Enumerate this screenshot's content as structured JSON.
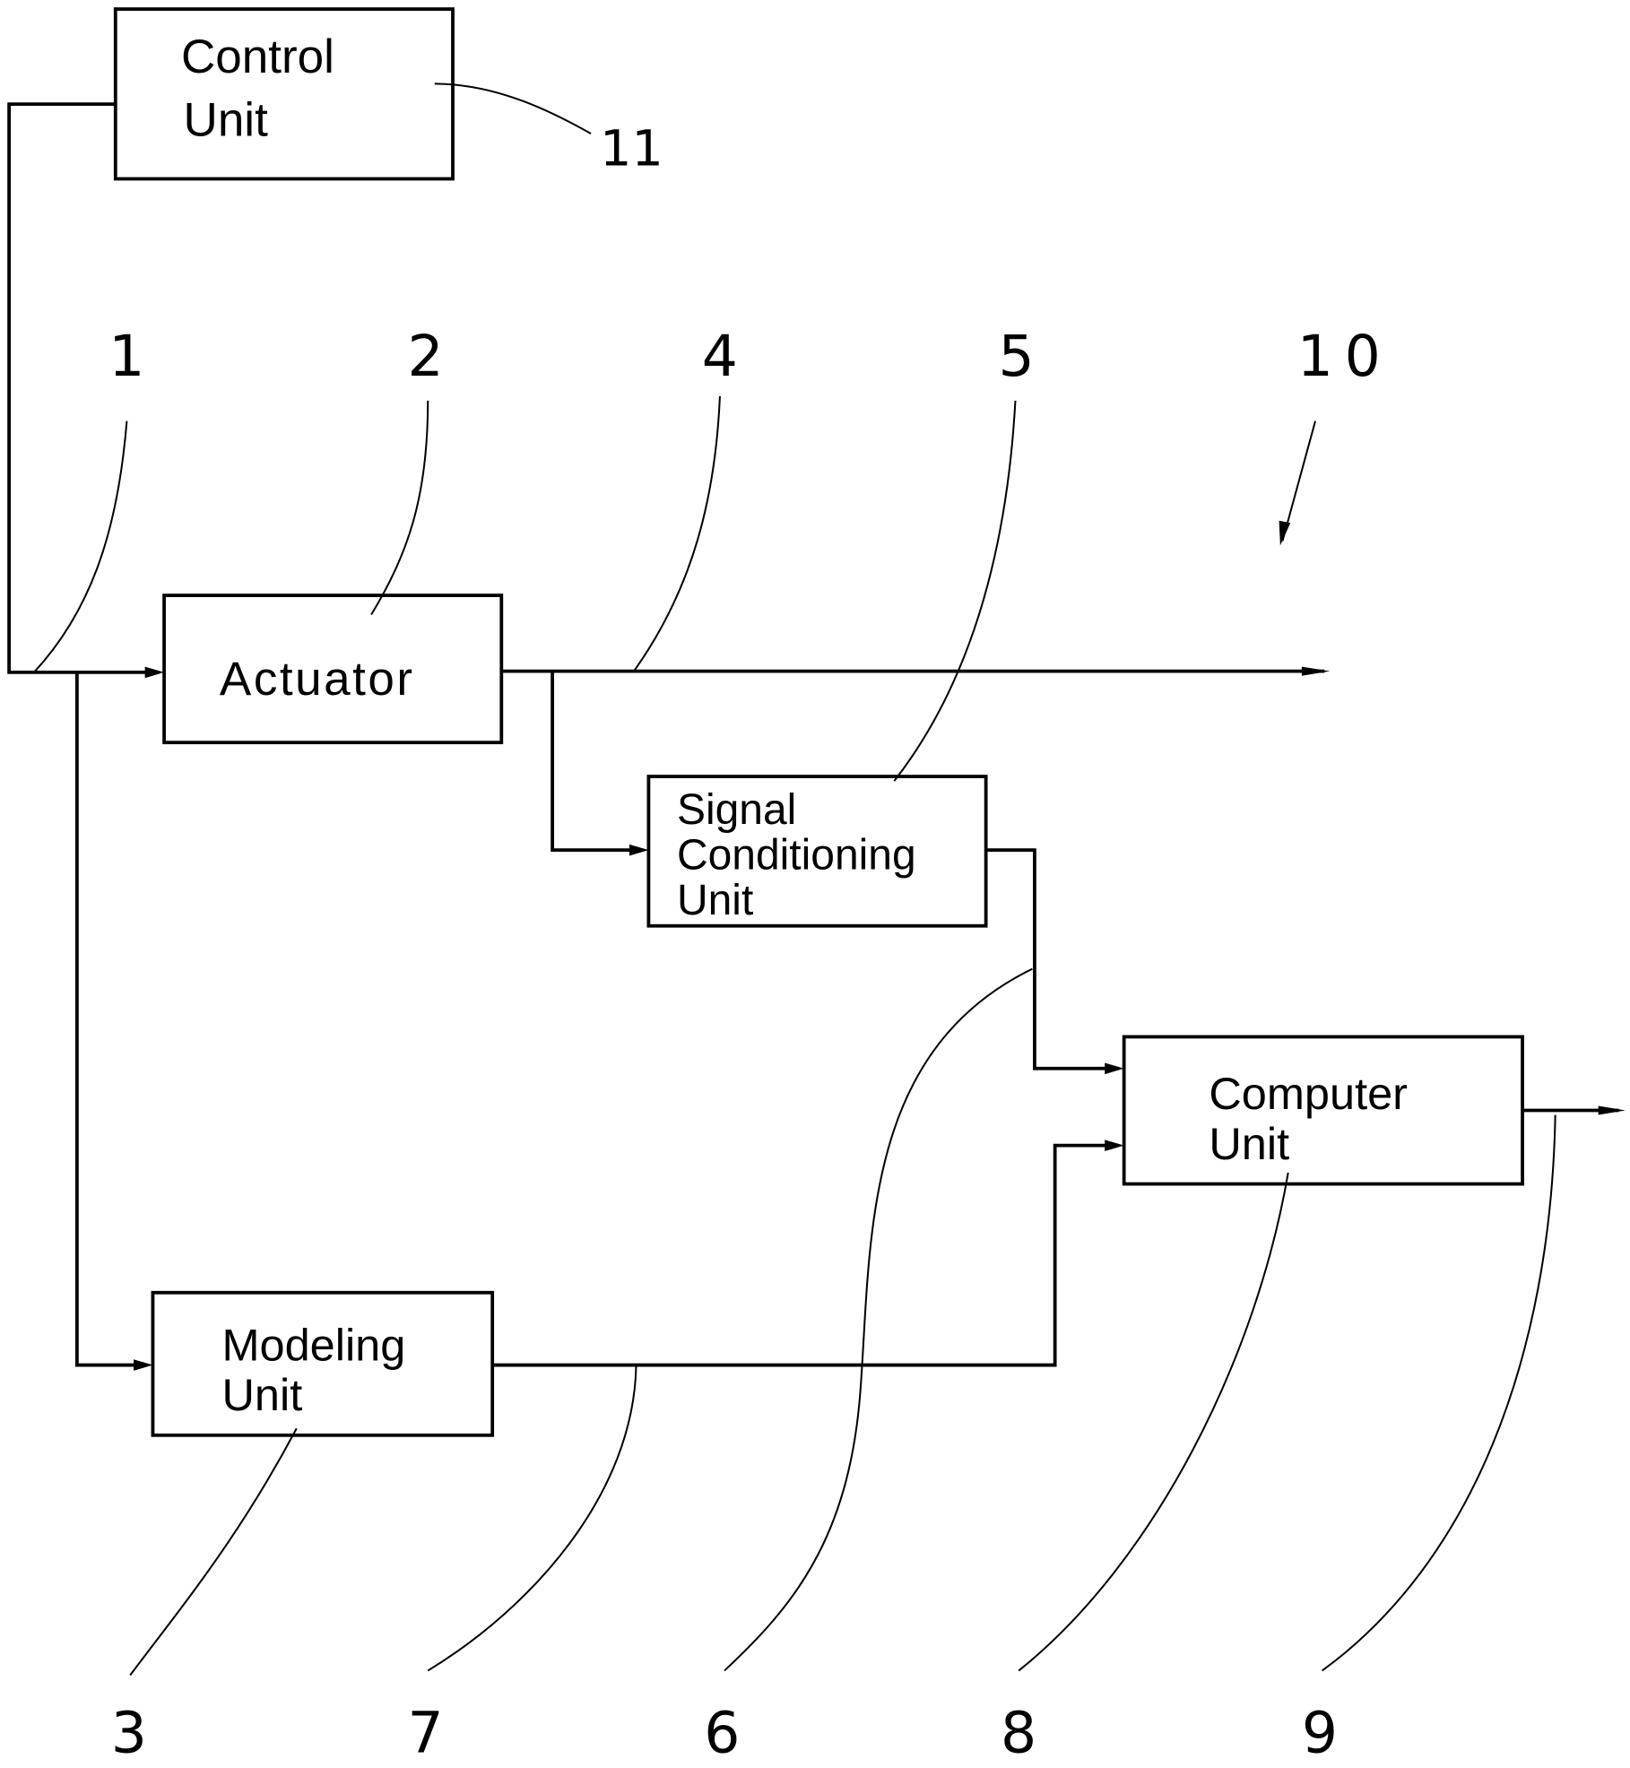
{
  "figure": {
    "blocks": {
      "control_unit": {
        "line1": "Control",
        "line2": "Unit",
        "ref": "11"
      },
      "actuator": {
        "line1": "Actuator",
        "ref": "2"
      },
      "signal_conditioning_unit": {
        "line1": "Signal",
        "line2": "Conditioning",
        "line3": "Unit",
        "ref": "5"
      },
      "computer_unit": {
        "line1": "Computer",
        "line2": "Unit",
        "ref": "8"
      },
      "modeling_unit": {
        "line1": "Modeling",
        "line2": "Unit",
        "ref": "3"
      }
    },
    "references": {
      "input_line": "1",
      "actuator": "2",
      "modeling_unit": "3",
      "actuator_output": "4",
      "signal_conditioning_unit": "5",
      "conditioned_signal": "6",
      "model_output": "7",
      "computer_unit": "8",
      "computer_output": "9",
      "system": "10",
      "control_unit": "11"
    }
  }
}
